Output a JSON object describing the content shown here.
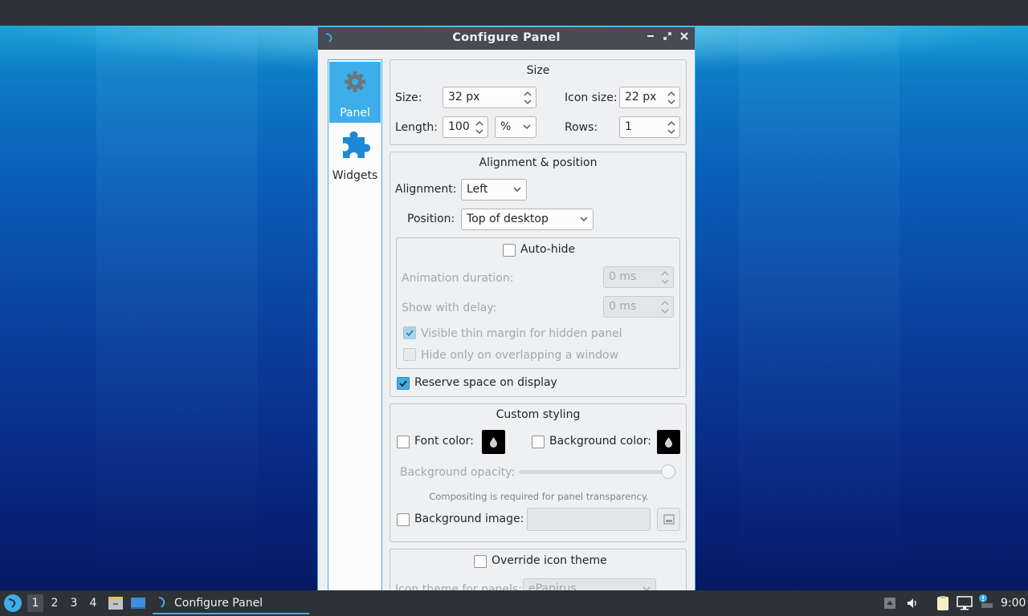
{
  "window": {
    "title": "Configure Panel",
    "minimize_label": "−",
    "maximize_label": "⤢",
    "close_label": "✕"
  },
  "sidebar": {
    "items": [
      {
        "label": "Panel",
        "icon": "gear-icon",
        "active": true
      },
      {
        "label": "Widgets",
        "icon": "puzzle-icon",
        "active": false
      }
    ]
  },
  "size_group": {
    "title": "Size",
    "size_label": "Size:",
    "size_value": "32 px",
    "icon_size_label": "Icon size:",
    "icon_size_value": "22 px",
    "length_label": "Length:",
    "length_value": "100",
    "length_unit": "%",
    "rows_label": "Rows:",
    "rows_value": "1"
  },
  "alignment_group": {
    "title": "Alignment & position",
    "alignment_label": "Alignment:",
    "alignment_value": "Left",
    "position_label": "Position:",
    "position_value": "Top of desktop",
    "autohide_label": "Auto-hide",
    "autohide_checked": false,
    "animation_label": "Animation duration:",
    "animation_value": "0 ms",
    "delay_label": "Show with delay:",
    "delay_value": "0 ms",
    "thin_margin_label": "Visible thin margin for hidden panel",
    "thin_margin_checked": true,
    "overlap_label": "Hide only on overlapping a window",
    "overlap_checked": false,
    "reserve_label": "Reserve space on display",
    "reserve_checked": true
  },
  "styling_group": {
    "title": "Custom styling",
    "font_color_label": "Font color:",
    "bg_color_label": "Background color:",
    "bg_opacity_label": "Background opacity:",
    "bg_opacity_value": 1.0,
    "compositing_note": "Compositing is required for panel transparency.",
    "bg_image_label": "Background image:",
    "bg_image_value": ""
  },
  "icon_theme_group": {
    "override_label": "Override icon theme",
    "theme_label": "Icon theme for panels:",
    "theme_value": "ePapirus"
  },
  "taskbar": {
    "desktops": [
      "1",
      "2",
      "3",
      "4"
    ],
    "active_desktop": "1",
    "task_label": "Configure Panel",
    "clock": "9:00"
  },
  "colors": {
    "accent": "#3daee9",
    "titlebar": "#474c53",
    "panel": "#2e3136",
    "window_bg": "#eff0f1"
  }
}
